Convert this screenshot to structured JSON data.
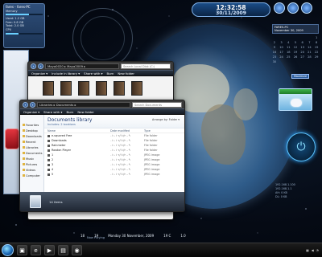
{
  "sysinfo": {
    "title": "fares - fares-PC",
    "memory_label": "Memory",
    "memory_used": 0.62,
    "lines": [
      "Used: 1.2 GB",
      "Free: 0.8 GB",
      "Total: 2.0 GB"
    ],
    "cpu_label": "CPU",
    "cpu_used": 0.34
  },
  "clock": {
    "time": "12:32:58",
    "date": "30/11/2009"
  },
  "calendar": {
    "header": "FARES-PC",
    "subheader": "November 30, 2009",
    "days": [
      "",
      "",
      "",
      "",
      "",
      "",
      "1",
      "2",
      "3",
      "4",
      "5",
      "6",
      "7",
      "8",
      "9",
      "10",
      "11",
      "12",
      "13",
      "14",
      "15",
      "16",
      "17",
      "18",
      "19",
      "20",
      "21",
      "22",
      "23",
      "24",
      "25",
      "26",
      "27",
      "28",
      "29",
      "30"
    ],
    "max_label": "Maximize"
  },
  "window_back": {
    "crumbs": "Maya0020 ▸ Maya2009 ▸",
    "search_placeholder": "Search Local Disk (C:)",
    "toolbar": [
      "Organize ▾",
      "Include in library ▾",
      "Share with ▾",
      "Burn",
      "New folder"
    ]
  },
  "window_front": {
    "crumbs": "Libraries ▸ Documents ▸",
    "search_placeholder": "Search Documents",
    "toolbar": [
      "Organize ▾",
      "Share with ▾",
      "Burn",
      "New folder"
    ],
    "sidebar": [
      "Favorites",
      "Desktop",
      "Downloads",
      "Recent",
      "Libraries",
      "Documents",
      "Music",
      "Pictures",
      "Videos",
      "Computer"
    ],
    "library_title": "Documents library",
    "library_sub": "Includes: 2 locations",
    "arrange_label": "Arrange by:",
    "arrange_value": "Folder ▾",
    "columns": [
      "Name",
      "Date modified",
      "Type"
    ],
    "files": [
      {
        "name": "e-squared Free",
        "date": "٢/١١/٢٠٠٩ ٠١:٠١",
        "type": "File folder"
      },
      {
        "name": "Downloads",
        "date": "٢/١١/٢٠٠٩ ٠١:٠١",
        "type": "File folder"
      },
      {
        "name": "Rainmeter",
        "date": "٢/١١/٢٠٠٩ ٠١:٠١",
        "type": "File folder"
      },
      {
        "name": "Rosdon Player",
        "date": "٢/١١/٢٠٠٩ ٠١:٠١",
        "type": "File folder"
      },
      {
        "name": "1",
        "date": "٢/١١/٢٠٠٩ ٠١:٠١",
        "type": "JPEG image"
      },
      {
        "name": "2",
        "date": "٢/١١/٢٠٠٩ ٠١:٠١",
        "type": "JPEG image"
      },
      {
        "name": "3",
        "date": "٢/١١/٢٠٠٩ ٠١:٠١",
        "type": "JPEG image"
      },
      {
        "name": "4",
        "date": "٢/١١/٢٠٠٩ ٠١:٠١",
        "type": "JPEG image"
      },
      {
        "name": "5",
        "date": "٢/١١/٢٠٠٩ ٠١:٠١",
        "type": "JPEG image"
      }
    ],
    "item_count": "14 items"
  },
  "infostrip": {
    "now_playing": "Now Playing",
    "items": [
      "18",
      "19",
      "Monday 30 November, 2009",
      "19 C",
      "1.0"
    ]
  },
  "net": {
    "lines": [
      "192.168.1.100",
      "192.168.1.1",
      "AH: 0 KB",
      "DL: 0 KB"
    ]
  },
  "colors": {
    "accent": "#1e3a72",
    "clock_bg": "#1a4c86",
    "power_glow": "#2aa3ff"
  }
}
